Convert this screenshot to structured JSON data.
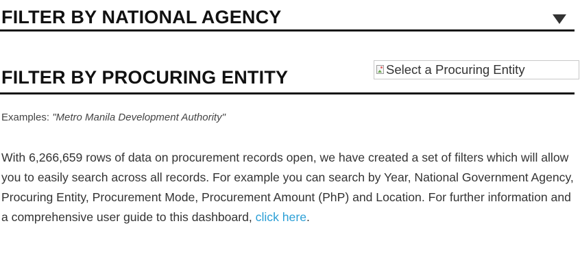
{
  "national_agency": {
    "title": "FILTER BY NATIONAL AGENCY",
    "dropdown_icon": "caret-down-icon"
  },
  "procuring_entity": {
    "title": "FILTER BY PROCURING ENTITY",
    "select_alt": "Select a Procuring Entity",
    "select_icon": "broken-image-icon"
  },
  "examples": {
    "prefix": "Examples: ",
    "value": "\"Metro Manila Development Authority\""
  },
  "description": {
    "text": "With 6,266,659 rows of data on procurement records open, we have created a set of filters which will allow you to easily search across all records. For example you can search by Year, National Government Agency, Procuring Entity, Procurement Mode, Procurement Amount (PhP) and Location. For further information and a comprehensive user guide to this dashboard, ",
    "link_text": "click here",
    "suffix": "."
  },
  "colors": {
    "link": "#2b9fd6",
    "heading": "#111111",
    "body_text": "#333333"
  }
}
